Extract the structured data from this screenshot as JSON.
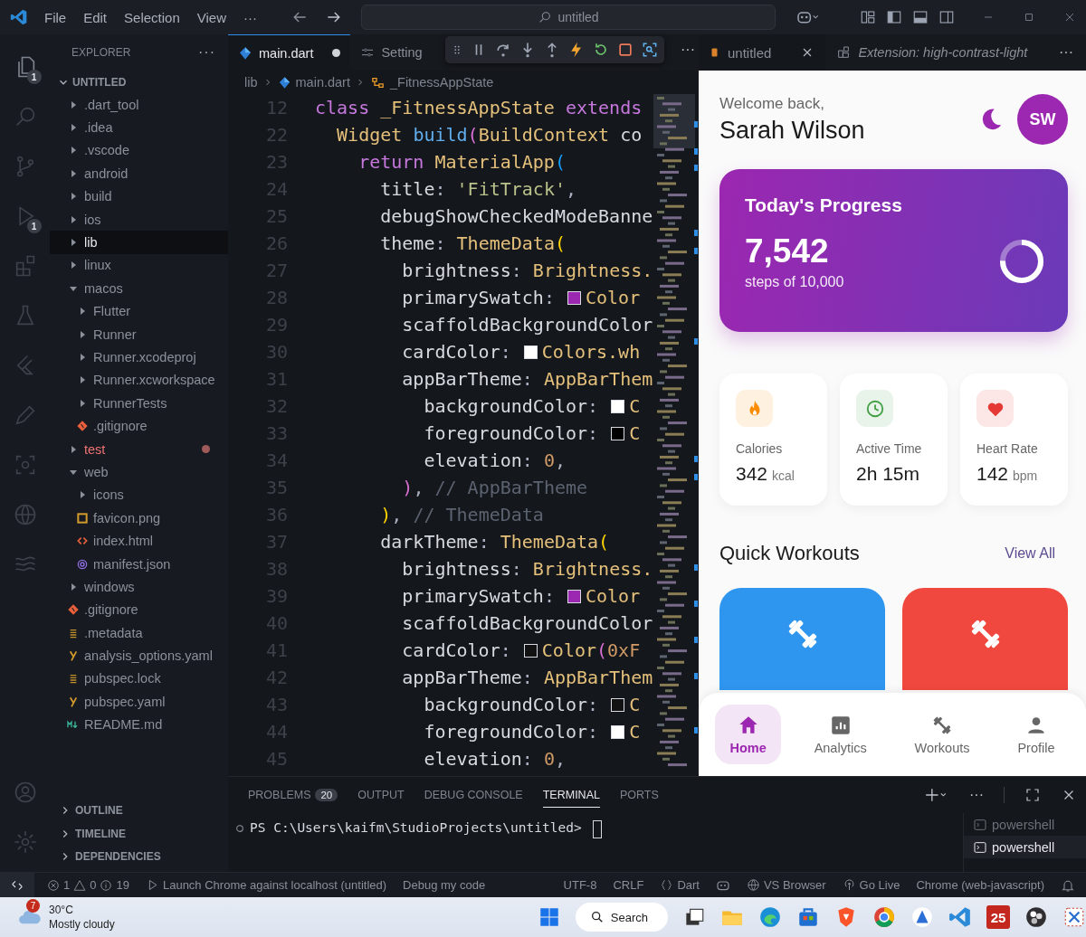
{
  "title_bar": {
    "menu": [
      "File",
      "Edit",
      "Selection",
      "View",
      "···"
    ],
    "search": "untitled"
  },
  "activity_bar": {
    "top": [
      {
        "kind": "files",
        "badge": "1",
        "selected": true
      },
      {
        "kind": "search",
        "selected": false
      },
      {
        "kind": "branch",
        "selected": false
      },
      {
        "kind": "run",
        "badge": "1",
        "selected": false
      },
      {
        "kind": "blocks",
        "selected": false
      },
      {
        "kind": "flask",
        "selected": false
      },
      {
        "kind": "arrow",
        "selected": false
      },
      {
        "kind": "pencil",
        "selected": false
      },
      {
        "kind": "scan",
        "selected": false
      },
      {
        "kind": "globe",
        "selected": false
      },
      {
        "kind": "waves",
        "selected": false
      }
    ],
    "bottom": [
      {
        "kind": "account",
        "selected": false
      },
      {
        "kind": "settings",
        "selected": false
      }
    ]
  },
  "explorer": {
    "title": "EXPLORER",
    "more": "···",
    "root": {
      "label": "UNTITLED",
      "expanded": true
    },
    "items": [
      {
        "label": ".dart_tool",
        "kind": "folder",
        "expanded": false,
        "selected": false,
        "error": false
      },
      {
        "label": ".idea",
        "kind": "folder",
        "expanded": false,
        "selected": false,
        "error": false
      },
      {
        "label": ".vscode",
        "kind": "folder",
        "expanded": false,
        "selected": false,
        "error": false
      },
      {
        "label": "android",
        "kind": "folder",
        "expanded": false,
        "selected": false,
        "error": false
      },
      {
        "label": "build",
        "kind": "folder",
        "expanded": false,
        "selected": false,
        "error": false
      },
      {
        "label": "ios",
        "kind": "folder",
        "expanded": false,
        "selected": false,
        "error": false
      },
      {
        "label": "lib",
        "kind": "folder",
        "expanded": false,
        "selected": true,
        "error": false
      },
      {
        "label": "linux",
        "kind": "folder",
        "expanded": false,
        "selected": false,
        "error": false
      },
      {
        "label": "macos",
        "kind": "folder",
        "expanded": true,
        "selected": false,
        "error": false,
        "children": [
          {
            "label": "Flutter",
            "kind": "folder",
            "expanded": false,
            "selected": false,
            "error": false
          },
          {
            "label": "Runner",
            "kind": "folder",
            "expanded": false,
            "selected": false,
            "error": false
          },
          {
            "label": "Runner.xcodeproj",
            "kind": "folder",
            "expanded": false,
            "selected": false,
            "error": false
          },
          {
            "label": "Runner.xcworkspace",
            "kind": "folder",
            "expanded": false,
            "selected": false,
            "error": false
          },
          {
            "label": "RunnerTests",
            "kind": "folder",
            "expanded": false,
            "selected": false,
            "error": false
          },
          {
            "label": ".gitignore",
            "kind": "git",
            "selected": false,
            "error": false
          }
        ]
      },
      {
        "label": "test",
        "kind": "folder",
        "expanded": false,
        "selected": false,
        "error": true
      },
      {
        "label": "web",
        "kind": "folder",
        "expanded": true,
        "selected": false,
        "error": false,
        "children": [
          {
            "label": "icons",
            "kind": "folder",
            "expanded": false,
            "selected": false,
            "error": false
          },
          {
            "label": "favicon.png",
            "kind": "image",
            "selected": false,
            "error": false
          },
          {
            "label": "index.html",
            "kind": "html",
            "selected": false,
            "error": false
          },
          {
            "label": "manifest.json",
            "kind": "json",
            "selected": false,
            "error": false
          }
        ]
      },
      {
        "label": "windows",
        "kind": "folder",
        "expanded": false,
        "selected": false,
        "error": false
      },
      {
        "label": ".gitignore",
        "kind": "git",
        "selected": false,
        "error": false
      },
      {
        "label": ".metadata",
        "kind": "lines",
        "selected": false,
        "error": false
      },
      {
        "label": "analysis_options.yaml",
        "kind": "yaml",
        "selected": false,
        "error": false
      },
      {
        "label": "pubspec.lock",
        "kind": "lines",
        "selected": false,
        "error": false
      },
      {
        "label": "pubspec.yaml",
        "kind": "yaml",
        "selected": false,
        "error": false
      },
      {
        "label": "README.md",
        "kind": "markdown",
        "selected": false,
        "error": false
      }
    ],
    "sections": [
      {
        "label": "OUTLINE",
        "expanded": false
      },
      {
        "label": "TIMELINE",
        "expanded": false
      },
      {
        "label": "DEPENDENCIES",
        "expanded": false
      }
    ]
  },
  "editor": {
    "tabs": [
      {
        "label": "main.dart",
        "kind": "dart",
        "selected": true,
        "dirty": true
      },
      {
        "label": "Setting",
        "kind": "settings",
        "selected": false
      }
    ],
    "more": "···",
    "breadcrumbs": [
      "lib",
      "main.dart",
      "_FitnessAppState"
    ],
    "lines": [
      {
        "number": "12",
        "tokens": [
          {
            "kind": "kw",
            "text": "class "
          },
          {
            "kind": "type",
            "text": "_FitnessAppState "
          },
          {
            "kind": "kw",
            "text": "extends"
          }
        ]
      },
      {
        "number": "22",
        "tokens": [
          {
            "kind": "type",
            "text": "  Widget "
          },
          {
            "kind": "fn",
            "text": "build"
          },
          {
            "kind": "bracket",
            "text": "(",
            "color": "#da70d6"
          },
          {
            "kind": "type",
            "text": "BuildContext"
          },
          {
            "kind": "prop",
            "text": " co"
          }
        ]
      },
      {
        "number": "23",
        "tokens": [
          {
            "kind": "kw",
            "text": "    return "
          },
          {
            "kind": "type",
            "text": "MaterialApp"
          },
          {
            "kind": "bracket",
            "text": "(",
            "color": "#179fff"
          }
        ]
      },
      {
        "number": "24",
        "tokens": [
          {
            "kind": "prop",
            "text": "      title"
          },
          {
            "kind": "punct",
            "text": ": "
          },
          {
            "kind": "str",
            "text": "'FitTrack'"
          },
          {
            "kind": "punct",
            "text": ","
          }
        ]
      },
      {
        "number": "25",
        "tokens": [
          {
            "kind": "prop",
            "text": "      debugShowCheckedModeBanne"
          }
        ]
      },
      {
        "number": "26",
        "tokens": [
          {
            "kind": "prop",
            "text": "      theme"
          },
          {
            "kind": "punct",
            "text": ": "
          },
          {
            "kind": "type",
            "text": "ThemeData"
          },
          {
            "kind": "bracket",
            "text": "(",
            "color": "#ffd700"
          }
        ]
      },
      {
        "number": "27",
        "tokens": [
          {
            "kind": "prop",
            "text": "        brightness"
          },
          {
            "kind": "punct",
            "text": ": "
          },
          {
            "kind": "type",
            "text": "Brightness."
          }
        ]
      },
      {
        "number": "28",
        "tokens": [
          {
            "kind": "prop",
            "text": "        primarySwatch"
          },
          {
            "kind": "punct",
            "text": ": "
          },
          {
            "kind": "swatch",
            "color": "#9c27b0"
          },
          {
            "kind": "type",
            "text": "Color"
          }
        ]
      },
      {
        "number": "29",
        "tokens": [
          {
            "kind": "prop",
            "text": "        scaffoldBackgroundColor"
          }
        ]
      },
      {
        "number": "30",
        "tokens": [
          {
            "kind": "prop",
            "text": "        cardColor"
          },
          {
            "kind": "punct",
            "text": ": "
          },
          {
            "kind": "swatch",
            "color": "#ffffff"
          },
          {
            "kind": "type",
            "text": "Colors.wh"
          }
        ]
      },
      {
        "number": "31",
        "tokens": [
          {
            "kind": "prop",
            "text": "        appBarTheme"
          },
          {
            "kind": "punct",
            "text": ": "
          },
          {
            "kind": "type",
            "text": "AppBarThem"
          }
        ]
      },
      {
        "number": "32",
        "tokens": [
          {
            "kind": "prop",
            "text": "          backgroundColor"
          },
          {
            "kind": "punct",
            "text": ": "
          },
          {
            "kind": "swatch",
            "color": "#ffffff"
          },
          {
            "kind": "type",
            "text": "C"
          }
        ]
      },
      {
        "number": "33",
        "tokens": [
          {
            "kind": "prop",
            "text": "          foregroundColor"
          },
          {
            "kind": "punct",
            "text": ": "
          },
          {
            "kind": "swatch",
            "color": "#000000"
          },
          {
            "kind": "type",
            "text": "C"
          }
        ]
      },
      {
        "number": "34",
        "tokens": [
          {
            "kind": "prop",
            "text": "          elevation"
          },
          {
            "kind": "punct",
            "text": ": "
          },
          {
            "kind": "num",
            "text": "0"
          },
          {
            "kind": "punct",
            "text": ","
          }
        ]
      },
      {
        "number": "35",
        "tokens": [
          {
            "kind": "bracket",
            "text": "        )",
            "color": "#da70d6"
          },
          {
            "kind": "punct",
            "text": ", "
          },
          {
            "kind": "cmt",
            "text": "// AppBarTheme"
          }
        ]
      },
      {
        "number": "36",
        "tokens": [
          {
            "kind": "bracket",
            "text": "      )",
            "color": "#ffd700"
          },
          {
            "kind": "punct",
            "text": ", "
          },
          {
            "kind": "cmt",
            "text": "// ThemeData"
          }
        ]
      },
      {
        "number": "37",
        "tokens": [
          {
            "kind": "prop",
            "text": "      darkTheme"
          },
          {
            "kind": "punct",
            "text": ": "
          },
          {
            "kind": "type",
            "text": "ThemeData"
          },
          {
            "kind": "bracket",
            "text": "(",
            "color": "#ffd700"
          }
        ]
      },
      {
        "number": "38",
        "tokens": [
          {
            "kind": "prop",
            "text": "        brightness"
          },
          {
            "kind": "punct",
            "text": ": "
          },
          {
            "kind": "type",
            "text": "Brightness."
          }
        ]
      },
      {
        "number": "39",
        "tokens": [
          {
            "kind": "prop",
            "text": "        primarySwatch"
          },
          {
            "kind": "punct",
            "text": ": "
          },
          {
            "kind": "swatch",
            "color": "#9c27b0"
          },
          {
            "kind": "type",
            "text": "Color"
          }
        ]
      },
      {
        "number": "40",
        "tokens": [
          {
            "kind": "prop",
            "text": "        scaffoldBackgroundColor"
          }
        ]
      },
      {
        "number": "41",
        "tokens": [
          {
            "kind": "prop",
            "text": "        cardColor"
          },
          {
            "kind": "punct",
            "text": ": "
          },
          {
            "kind": "swatch",
            "color": "#121212"
          },
          {
            "kind": "type",
            "text": "Color"
          },
          {
            "kind": "bracket",
            "text": "(",
            "color": "#da70d6"
          },
          {
            "kind": "num",
            "text": "0xF"
          }
        ]
      },
      {
        "number": "42",
        "tokens": [
          {
            "kind": "prop",
            "text": "        appBarTheme"
          },
          {
            "kind": "punct",
            "text": ": "
          },
          {
            "kind": "type",
            "text": "AppBarThem"
          }
        ]
      },
      {
        "number": "43",
        "tokens": [
          {
            "kind": "prop",
            "text": "          backgroundColor"
          },
          {
            "kind": "punct",
            "text": ": "
          },
          {
            "kind": "swatch",
            "color": "#121212"
          },
          {
            "kind": "type",
            "text": "C"
          }
        ]
      },
      {
        "number": "44",
        "tokens": [
          {
            "kind": "prop",
            "text": "          foregroundColor"
          },
          {
            "kind": "punct",
            "text": ": "
          },
          {
            "kind": "swatch",
            "color": "#ffffff"
          },
          {
            "kind": "type",
            "text": "C"
          }
        ]
      },
      {
        "number": "45",
        "tokens": [
          {
            "kind": "prop",
            "text": "          elevation"
          },
          {
            "kind": "punct",
            "text": ": "
          },
          {
            "kind": "num",
            "text": "0"
          },
          {
            "kind": "punct",
            "text": ","
          }
        ]
      }
    ]
  },
  "preview_tabs": {
    "tabs": [
      {
        "label": "untitled",
        "selected": true,
        "preview": false
      },
      {
        "label": "Extension: high-contrast-light",
        "selected": false,
        "preview": true
      }
    ],
    "more": "···"
  },
  "app": {
    "greeting": "Welcome back,",
    "name": "Sarah Wilson",
    "avatar": "SW",
    "progress": {
      "title": "Today's Progress",
      "value": "7,542",
      "caption": "steps of 10,000",
      "level": 0.75
    },
    "stats": [
      {
        "kind": "flame",
        "color": "#fb8c00",
        "label": "Calories",
        "value": "342",
        "unit": "kcal"
      },
      {
        "kind": "clock",
        "color": "#43a047",
        "label": "Active Time",
        "value": "2h 15m"
      },
      {
        "kind": "heart",
        "color": "#e53935",
        "label": "Heart Rate",
        "value": "142",
        "unit": "bpm"
      }
    ],
    "section_title": "Quick Workouts",
    "view_all": "View All",
    "workouts": [
      {
        "color": "#2f96f0"
      },
      {
        "color": "#f0483e"
      }
    ],
    "nav": [
      {
        "kind": "home",
        "label": "Home",
        "selected": true
      },
      {
        "kind": "analytics",
        "label": "Analytics",
        "selected": false
      },
      {
        "kind": "dumbbell",
        "label": "Workouts",
        "selected": false
      },
      {
        "kind": "person",
        "label": "Profile",
        "selected": false
      }
    ]
  },
  "panel": {
    "tabs": [
      {
        "label": "PROBLEMS",
        "badge": "20",
        "selected": false
      },
      {
        "label": "OUTPUT",
        "selected": false
      },
      {
        "label": "DEBUG CONSOLE",
        "selected": false
      },
      {
        "label": "TERMINAL",
        "selected": true
      },
      {
        "label": "PORTS",
        "selected": false
      }
    ],
    "more": "···",
    "prompt": "PS C:\\Users\\kaifm\\StudioProjects\\untitled>",
    "terminals": [
      {
        "label": "powershell",
        "selected": false
      },
      {
        "label": "powershell",
        "selected": true
      }
    ]
  },
  "status_bar": [
    {
      "kind": "remote"
    },
    {
      "kind": "problems",
      "errors": "1",
      "warnings": "0",
      "infos": "19"
    },
    {
      "kind": "launch",
      "text": "Launch Chrome against localhost (untitled)"
    },
    {
      "kind": "text",
      "text": "Debug my code"
    },
    {
      "kind": "spacer"
    },
    {
      "kind": "text",
      "text": "UTF-8"
    },
    {
      "kind": "text",
      "text": "CRLF"
    },
    {
      "kind": "language",
      "text": "Dart"
    },
    {
      "kind": "copilot"
    },
    {
      "kind": "browser",
      "text": "VS Browser"
    },
    {
      "kind": "live",
      "text": "Go Live"
    },
    {
      "kind": "text",
      "text": "Chrome (web-javascript)"
    },
    {
      "kind": "bell"
    }
  ],
  "taskbar": {
    "weather": {
      "badge": "7",
      "temp": "30°C",
      "text": "Mostly cloudy"
    },
    "search": "Search",
    "apps": [
      {
        "kind": "start"
      },
      {
        "kind": "search"
      },
      {
        "kind": "taskview"
      },
      {
        "kind": "folder"
      },
      {
        "kind": "swirl"
      },
      {
        "kind": "bag"
      },
      {
        "kind": "shield"
      },
      {
        "kind": "ring"
      },
      {
        "kind": "triangle"
      },
      {
        "kind": "vscode"
      },
      {
        "kind": "tile",
        "text": "25"
      },
      {
        "kind": "dots"
      },
      {
        "kind": "scissors"
      }
    ]
  }
}
